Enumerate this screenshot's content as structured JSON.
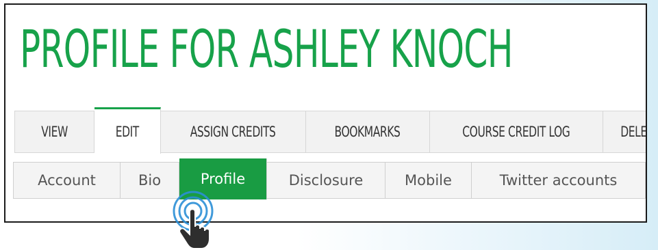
{
  "page": {
    "title": "PROFILE FOR ASHLEY KNOCH"
  },
  "primary_tabs": [
    {
      "label": "VIEW"
    },
    {
      "label": "EDIT",
      "active": true
    },
    {
      "label": "ASSIGN CREDITS"
    },
    {
      "label": "BOOKMARKS"
    },
    {
      "label": "COURSE CREDIT LOG"
    },
    {
      "label": "DELET"
    }
  ],
  "secondary_tabs": [
    {
      "label": "Account"
    },
    {
      "label": "Bio"
    },
    {
      "label": "Profile",
      "active": true
    },
    {
      "label": "Disclosure"
    },
    {
      "label": "Mobile"
    },
    {
      "label": "Twitter accounts"
    }
  ],
  "colors": {
    "brand_green": "#17a24a",
    "active_subtab": "#199c43",
    "click_ripple": "#2b8fd6"
  },
  "icons": {
    "cursor": "hand-pointer-icon",
    "click": "click-ripple-icon"
  }
}
